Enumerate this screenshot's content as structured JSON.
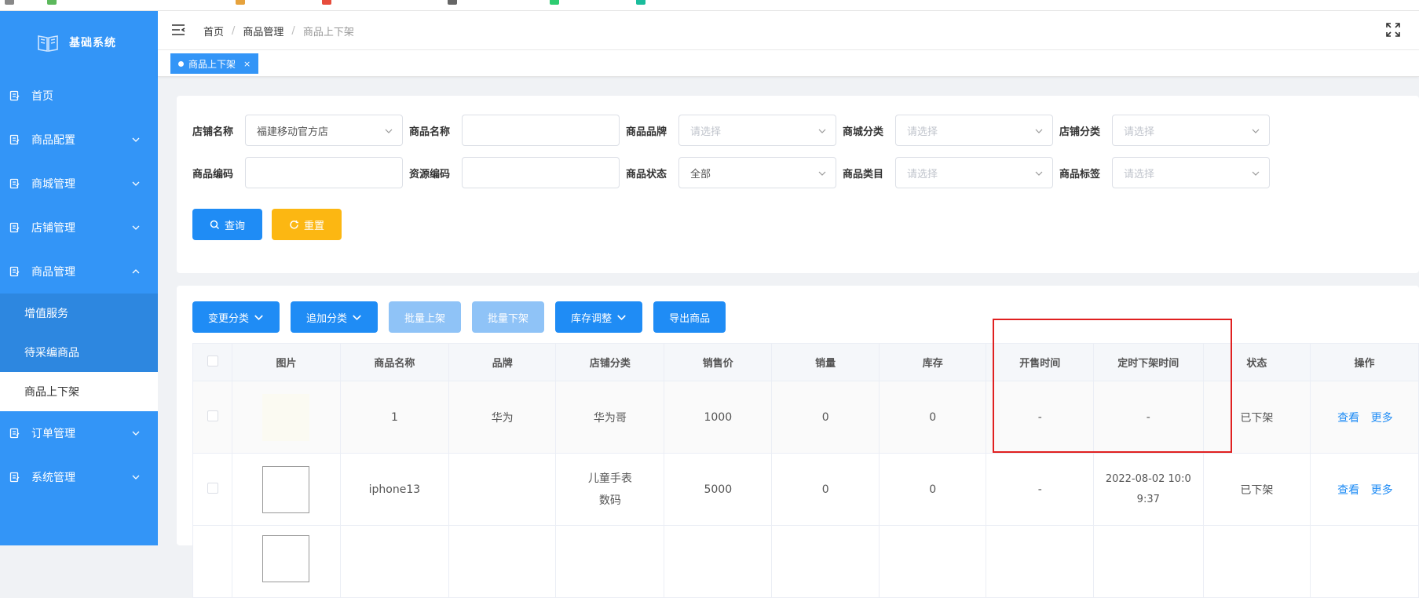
{
  "sidebar": {
    "title": "基础系统",
    "menu": [
      {
        "label": "首页"
      },
      {
        "label": "商品配置"
      },
      {
        "label": "商城管理"
      },
      {
        "label": "店铺管理"
      },
      {
        "label": "商品管理"
      }
    ],
    "submenu": [
      {
        "label": "增值服务"
      },
      {
        "label": "待采编商品"
      },
      {
        "label": "商品上下架"
      }
    ],
    "menu_after": [
      {
        "label": "订单管理"
      },
      {
        "label": "系统管理"
      }
    ],
    "bg_color": "#3395f7"
  },
  "breadcrumb": {
    "home": "首页",
    "parent": "商品管理",
    "current": "商品上下架",
    "sep": "/"
  },
  "tab": {
    "label": "商品上下架",
    "close": "×"
  },
  "filters": {
    "shop_name": {
      "label": "店铺名称",
      "value": "福建移动官方店"
    },
    "product_name": {
      "label": "商品名称",
      "value": ""
    },
    "brand": {
      "label": "商品品牌",
      "placeholder": "请选择"
    },
    "mall_category": {
      "label": "商城分类",
      "placeholder": "请选择"
    },
    "shop_category": {
      "label": "店铺分类",
      "placeholder": "请选择"
    },
    "product_code": {
      "label": "商品编码",
      "value": ""
    },
    "resource_code": {
      "label": "资源编码",
      "value": ""
    },
    "status": {
      "label": "商品状态",
      "value": "全部"
    },
    "product_type": {
      "label": "商品类目",
      "placeholder": "请选择"
    },
    "product_tag": {
      "label": "商品标签",
      "placeholder": "请选择"
    },
    "query_btn": "查询",
    "reset_btn": "重置"
  },
  "toolbar": {
    "change_category": "变更分类",
    "add_category": "追加分类",
    "batch_on": "批量上架",
    "batch_off": "批量下架",
    "stock_adjust": "库存调整",
    "export": "导出商品"
  },
  "table": {
    "headers": [
      "图片",
      "商品名称",
      "品牌",
      "店铺分类",
      "销售价",
      "销量",
      "库存",
      "开售时间",
      "定时下架时间",
      "状态",
      "操作"
    ],
    "rows": [
      {
        "name": "1",
        "brand": "华为",
        "shop_category": "华为哥",
        "price": "1000",
        "sales": "0",
        "stock": "0",
        "sale_time": "-",
        "off_time": "-",
        "status": "已下架",
        "view": "查看",
        "more": "更多"
      },
      {
        "name": "iphone13",
        "brand": "",
        "shop_category": "儿童手表数码",
        "price": "5000",
        "sales": "0",
        "stock": "0",
        "sale_time": "-",
        "off_time": "2022-08-02 10:09:37",
        "status": "已下架",
        "view": "查看",
        "more": "更多"
      }
    ]
  },
  "colors": {
    "primary": "#1f8cf5",
    "primary_light": "#8fc3f7",
    "warning": "#fcb712",
    "highlight": "#e02020"
  }
}
